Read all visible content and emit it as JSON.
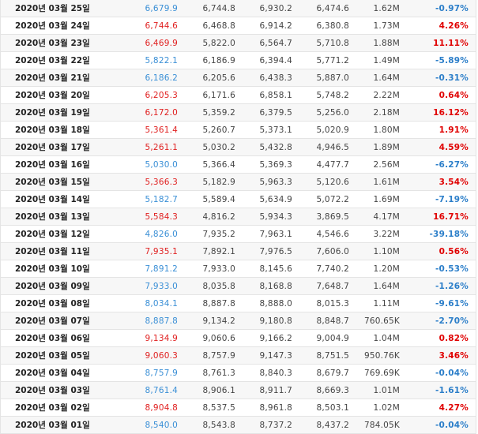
{
  "rows": [
    {
      "date": "2020년 03월 25일",
      "close": "6,679.9",
      "open": "6,744.8",
      "high": "6,930.2",
      "low": "6,474.6",
      "volume": "1.62M",
      "change": "-0.97%",
      "dir": "down"
    },
    {
      "date": "2020년 03월 24일",
      "close": "6,744.6",
      "open": "6,468.8",
      "high": "6,914.2",
      "low": "6,380.8",
      "volume": "1.73M",
      "change": "4.26%",
      "dir": "up"
    },
    {
      "date": "2020년 03월 23일",
      "close": "6,469.9",
      "open": "5,822.0",
      "high": "6,564.7",
      "low": "5,710.8",
      "volume": "1.88M",
      "change": "11.11%",
      "dir": "up"
    },
    {
      "date": "2020년 03월 22일",
      "close": "5,822.1",
      "open": "6,186.9",
      "high": "6,394.4",
      "low": "5,771.2",
      "volume": "1.49M",
      "change": "-5.89%",
      "dir": "down"
    },
    {
      "date": "2020년 03월 21일",
      "close": "6,186.2",
      "open": "6,205.6",
      "high": "6,438.3",
      "low": "5,887.0",
      "volume": "1.64M",
      "change": "-0.31%",
      "dir": "down"
    },
    {
      "date": "2020년 03월 20일",
      "close": "6,205.3",
      "open": "6,171.6",
      "high": "6,858.1",
      "low": "5,748.2",
      "volume": "2.22M",
      "change": "0.64%",
      "dir": "up"
    },
    {
      "date": "2020년 03월 19일",
      "close": "6,172.0",
      "open": "5,359.2",
      "high": "6,379.5",
      "low": "5,256.0",
      "volume": "2.18M",
      "change": "16.12%",
      "dir": "up"
    },
    {
      "date": "2020년 03월 18일",
      "close": "5,361.4",
      "open": "5,260.7",
      "high": "5,373.1",
      "low": "5,020.9",
      "volume": "1.80M",
      "change": "1.91%",
      "dir": "up"
    },
    {
      "date": "2020년 03월 17일",
      "close": "5,261.1",
      "open": "5,030.2",
      "high": "5,432.8",
      "low": "4,946.5",
      "volume": "1.89M",
      "change": "4.59%",
      "dir": "up"
    },
    {
      "date": "2020년 03월 16일",
      "close": "5,030.0",
      "open": "5,366.4",
      "high": "5,369.3",
      "low": "4,477.7",
      "volume": "2.56M",
      "change": "-6.27%",
      "dir": "down"
    },
    {
      "date": "2020년 03월 15일",
      "close": "5,366.3",
      "open": "5,182.9",
      "high": "5,963.3",
      "low": "5,120.6",
      "volume": "1.61M",
      "change": "3.54%",
      "dir": "up"
    },
    {
      "date": "2020년 03월 14일",
      "close": "5,182.7",
      "open": "5,589.4",
      "high": "5,634.9",
      "low": "5,072.2",
      "volume": "1.69M",
      "change": "-7.19%",
      "dir": "down"
    },
    {
      "date": "2020년 03월 13일",
      "close": "5,584.3",
      "open": "4,816.2",
      "high": "5,934.3",
      "low": "3,869.5",
      "volume": "4.17M",
      "change": "16.71%",
      "dir": "up"
    },
    {
      "date": "2020년 03월 12일",
      "close": "4,826.0",
      "open": "7,935.2",
      "high": "7,963.1",
      "low": "4,546.6",
      "volume": "3.22M",
      "change": "-39.18%",
      "dir": "down"
    },
    {
      "date": "2020년 03월 11일",
      "close": "7,935.1",
      "open": "7,892.1",
      "high": "7,976.5",
      "low": "7,606.0",
      "volume": "1.10M",
      "change": "0.56%",
      "dir": "up"
    },
    {
      "date": "2020년 03월 10일",
      "close": "7,891.2",
      "open": "7,933.0",
      "high": "8,145.6",
      "low": "7,740.2",
      "volume": "1.20M",
      "change": "-0.53%",
      "dir": "down"
    },
    {
      "date": "2020년 03월 09일",
      "close": "7,933.0",
      "open": "8,035.8",
      "high": "8,168.8",
      "low": "7,648.7",
      "volume": "1.64M",
      "change": "-1.26%",
      "dir": "down"
    },
    {
      "date": "2020년 03월 08일",
      "close": "8,034.1",
      "open": "8,887.8",
      "high": "8,888.0",
      "low": "8,015.3",
      "volume": "1.11M",
      "change": "-9.61%",
      "dir": "down"
    },
    {
      "date": "2020년 03월 07일",
      "close": "8,887.8",
      "open": "9,134.2",
      "high": "9,180.8",
      "low": "8,848.7",
      "volume": "760.65K",
      "change": "-2.70%",
      "dir": "down"
    },
    {
      "date": "2020년 03월 06일",
      "close": "9,134.9",
      "open": "9,060.6",
      "high": "9,166.2",
      "low": "9,004.9",
      "volume": "1.04M",
      "change": "0.82%",
      "dir": "up"
    },
    {
      "date": "2020년 03월 05일",
      "close": "9,060.3",
      "open": "8,757.9",
      "high": "9,147.3",
      "low": "8,751.5",
      "volume": "950.76K",
      "change": "3.46%",
      "dir": "up"
    },
    {
      "date": "2020년 03월 04일",
      "close": "8,757.9",
      "open": "8,761.3",
      "high": "8,840.3",
      "low": "8,679.7",
      "volume": "769.69K",
      "change": "-0.04%",
      "dir": "down"
    },
    {
      "date": "2020년 03월 03일",
      "close": "8,761.4",
      "open": "8,906.1",
      "high": "8,911.7",
      "low": "8,669.3",
      "volume": "1.01M",
      "change": "-1.61%",
      "dir": "down"
    },
    {
      "date": "2020년 03월 02일",
      "close": "8,904.8",
      "open": "8,537.5",
      "high": "8,961.8",
      "low": "8,503.1",
      "volume": "1.02M",
      "change": "4.27%",
      "dir": "up"
    },
    {
      "date": "2020년 03월 01일",
      "close": "8,540.0",
      "open": "8,543.8",
      "high": "8,737.2",
      "low": "8,437.2",
      "volume": "784.05K",
      "change": "-0.04%",
      "dir": "down"
    }
  ]
}
